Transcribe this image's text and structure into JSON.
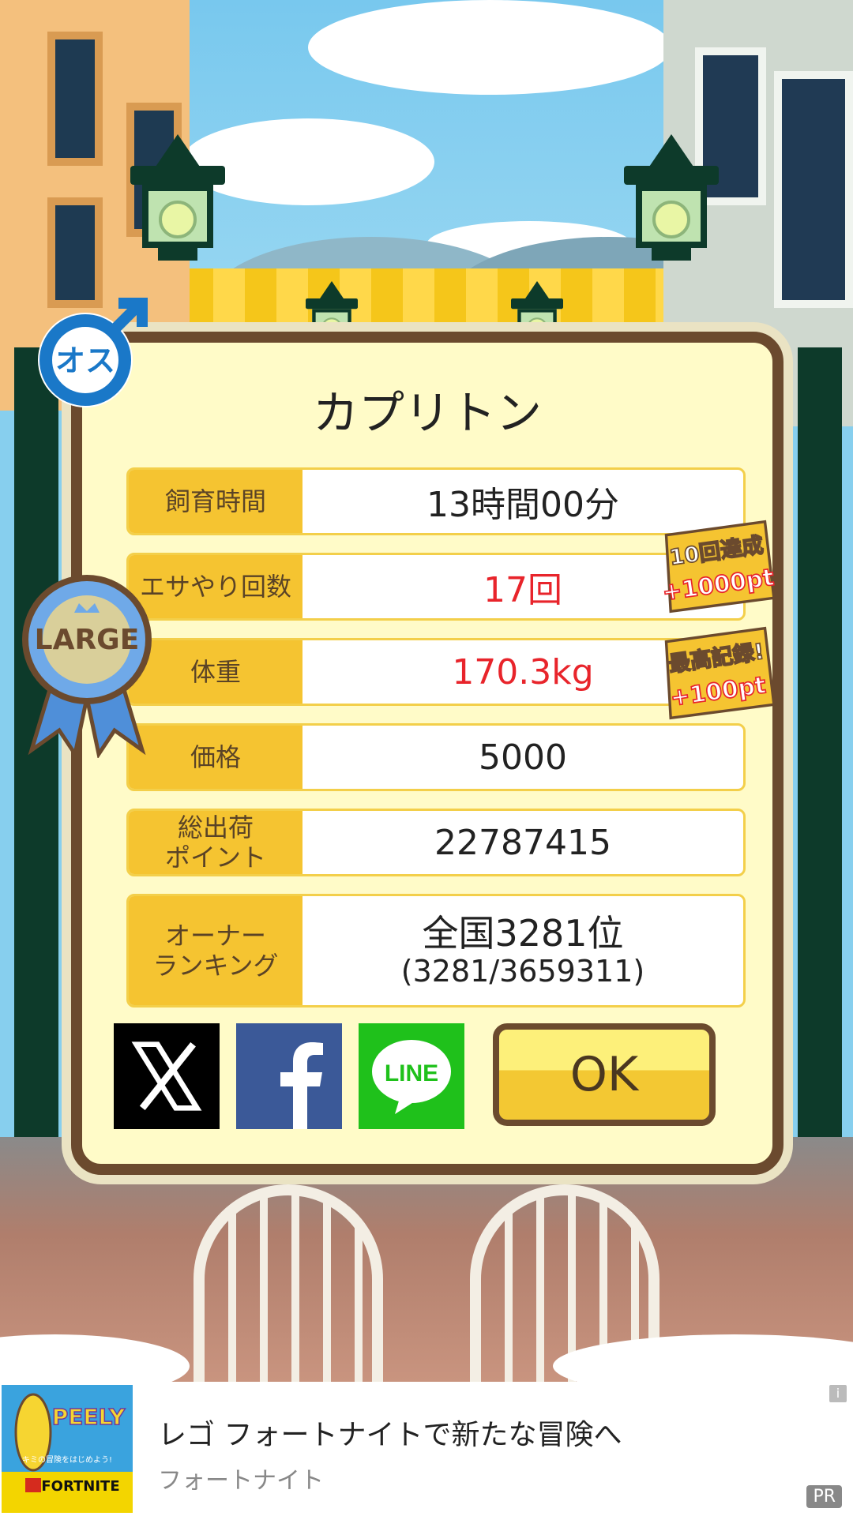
{
  "pet": {
    "name": "カプリトン",
    "gender_label": "オス",
    "size_badge": "LARGE"
  },
  "stats": [
    {
      "label": "飼育時間",
      "value": "13時間00分",
      "highlight": false
    },
    {
      "label": "エサやり回数",
      "value": "17回",
      "highlight": true
    },
    {
      "label": "体重",
      "value": "170.3kg",
      "highlight": true
    },
    {
      "label": "価格",
      "value": "5000",
      "highlight": false
    },
    {
      "label": "総出荷\nポイント",
      "value": "22787415",
      "highlight": false
    }
  ],
  "ranking": {
    "label": "オーナー\nランキング",
    "rank_text": "全国3281位",
    "detail": "(3281/3659311)"
  },
  "bonuses": [
    {
      "line1": "10回達成",
      "line2": "+1000pt"
    },
    {
      "line1": "最高記録!",
      "line2": "+100pt"
    }
  ],
  "share": {
    "x_icon": "x-logo-icon",
    "facebook_icon": "facebook-logo-icon",
    "line_label": "LINE"
  },
  "ok_button": "OK",
  "ad": {
    "title": "レゴ フォートナイトで新たな冒険へ",
    "sponsor": "フォートナイト",
    "pr_label": "PR",
    "image_text_1": "PEELY",
    "image_text_2": "キミの冒険をはじめよう!",
    "image_text_3": "FORTNITE"
  },
  "colors": {
    "dialog_bg": "#fffbc8",
    "dialog_border": "#6b4a2e",
    "label_bg": "#f5c431",
    "highlight_text": "#e8242b",
    "facebook": "#3b5998",
    "line": "#1fc11b"
  }
}
